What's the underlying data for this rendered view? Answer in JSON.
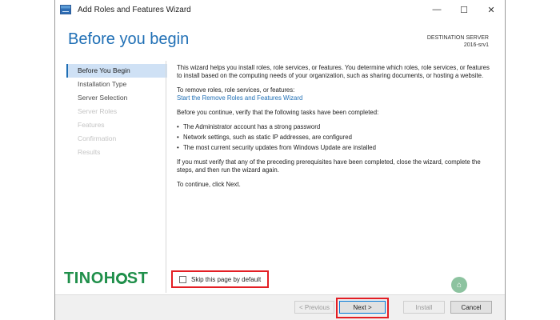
{
  "window": {
    "title": "Add Roles and Features Wizard",
    "controls": {
      "minimize": "—",
      "maximize": "☐",
      "close": "✕"
    }
  },
  "header": {
    "page_title": "Before you begin",
    "destination_label": "DESTINATION SERVER",
    "destination_value": "2016-srv1"
  },
  "nav": {
    "items": [
      {
        "label": "Before You Begin",
        "state": "active"
      },
      {
        "label": "Installation Type",
        "state": "normal"
      },
      {
        "label": "Server Selection",
        "state": "normal"
      },
      {
        "label": "Server Roles",
        "state": "dim"
      },
      {
        "label": "Features",
        "state": "dim"
      },
      {
        "label": "Confirmation",
        "state": "dim"
      },
      {
        "label": "Results",
        "state": "dim"
      }
    ]
  },
  "content": {
    "intro": "This wizard helps you install roles, role services, or features. You determine which roles, role services, or features to install based on the computing needs of your organization, such as sharing documents, or hosting a website.",
    "remove_prompt": "To remove roles, role services, or features:",
    "remove_link": "Start the Remove Roles and Features Wizard",
    "verify_prompt": "Before you continue, verify that the following tasks have been completed:",
    "bullets": [
      "The Administrator account has a strong password",
      "Network settings, such as static IP addresses, are configured",
      "The most current security updates from Windows Update are installed"
    ],
    "prereq_note": "If you must verify that any of the preceding prerequisites have been completed, close the wizard, complete the steps, and then run the wizard again.",
    "continue_note": "To continue, click Next."
  },
  "skip": {
    "label": "Skip this page by default",
    "checked": false
  },
  "buttons": {
    "previous": "< Previous",
    "next": "Next >",
    "install": "Install",
    "cancel": "Cancel"
  },
  "watermark": {
    "text_a": "TINO",
    "text_b": "H",
    "text_c": "ST"
  },
  "colors": {
    "accent": "#1f6fb5",
    "highlight": "#e31e24",
    "brand_green": "#1f8f4a"
  }
}
